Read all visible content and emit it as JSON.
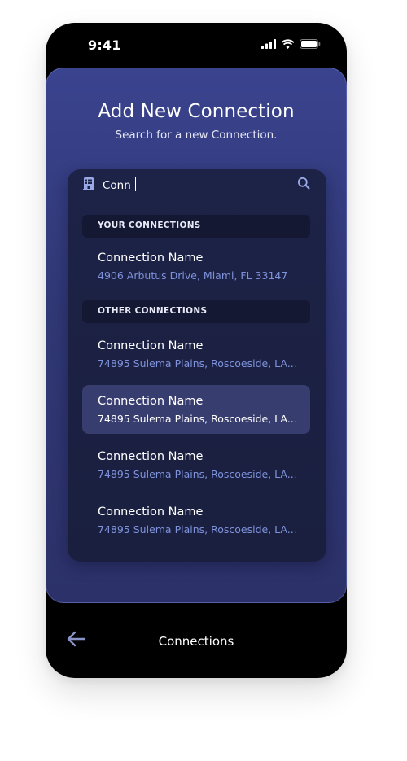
{
  "status_bar": {
    "time": "9:41",
    "icons": [
      "signal-icon",
      "wifi-icon",
      "battery-icon"
    ]
  },
  "header": {
    "title": "Add New Connection",
    "subtitle": "Search for a new Connection."
  },
  "search": {
    "value": "Conn",
    "leading_icon": "building-icon",
    "trailing_icon": "search-icon"
  },
  "sections": {
    "yours": {
      "label": "YOUR CONNECTIONS",
      "items": [
        {
          "name": "Connection Name",
          "address": "4906 Arbutus Drive, Miami, FL 33147"
        }
      ]
    },
    "other": {
      "label": "OTHER CONNECTIONS",
      "items": [
        {
          "name": "Connection Name",
          "address": "74895 Sulema Plains, Roscoeside, LA..."
        },
        {
          "name": "Connection Name",
          "address": "74895 Sulema Plains, Roscoeside, LA...",
          "selected": true
        },
        {
          "name": "Connection Name",
          "address": "74895 Sulema Plains, Roscoeside, LA..."
        },
        {
          "name": "Connection Name",
          "address": "74895 Sulema Plains, Roscoeside, LA..."
        }
      ]
    }
  },
  "bottom_bar": {
    "back_icon": "arrow-left-icon",
    "title": "Connections"
  },
  "colors": {
    "card_gradient_top": "#3a438e",
    "panel_background": "#1d2347",
    "section_header_background": "#141832",
    "selected_row_background": "#383d70",
    "address_text": "#7f93dc"
  }
}
